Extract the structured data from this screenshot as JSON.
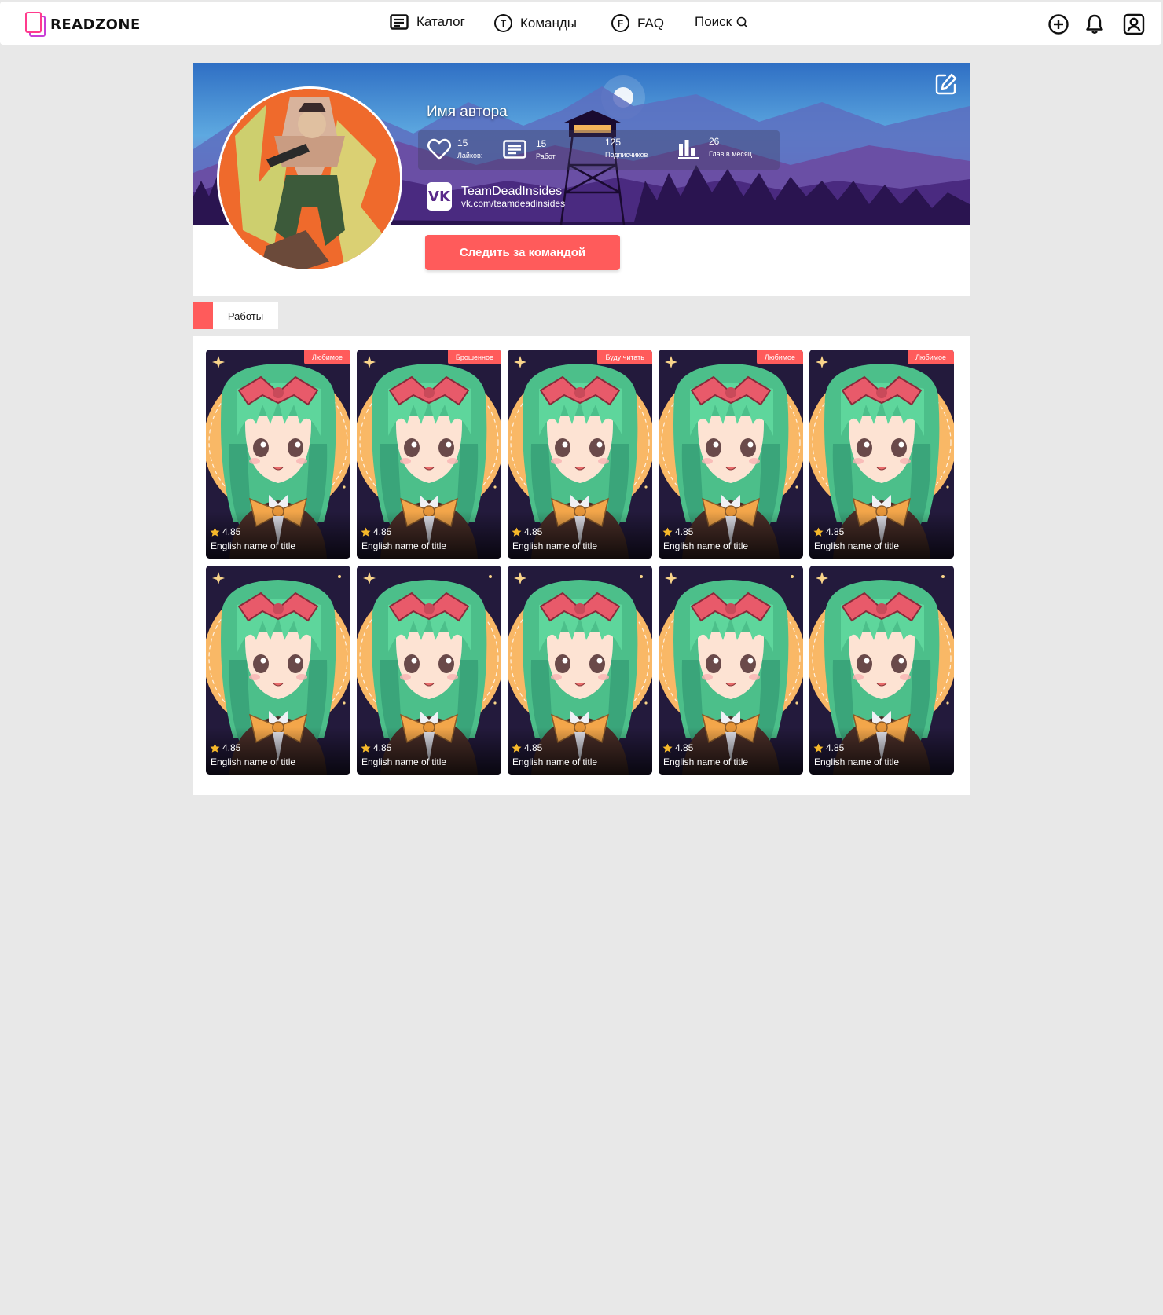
{
  "header": {
    "logo": "READZONE",
    "nav": {
      "catalog": "Каталог",
      "teams": "Команды",
      "faq": "FAQ",
      "search": "Поиск"
    }
  },
  "profile": {
    "author_name": "Имя автора",
    "stats": [
      {
        "value": "15",
        "label": "Лайков:"
      },
      {
        "value": "15",
        "label": "Работ"
      },
      {
        "value": "125",
        "label": "Подписчиков"
      },
      {
        "value": "26",
        "label": "Глав в месяц"
      }
    ],
    "vk": {
      "logo": "VK",
      "name": "TeamDeadInsides",
      "url": "vk.com/teamdeadinsides"
    },
    "follow_label": "Следить за командой"
  },
  "tabs": {
    "works_label": "Работы"
  },
  "works": [
    {
      "badge": "Любимое",
      "rating": "4.85",
      "title": "English name of title"
    },
    {
      "badge": "Брошенное",
      "rating": "4.85",
      "title": "English name of title"
    },
    {
      "badge": "Буду читать",
      "rating": "4.85",
      "title": "English name of title"
    },
    {
      "badge": "Любимое",
      "rating": "4.85",
      "title": "English name of title"
    },
    {
      "badge": "Любимое",
      "rating": "4.85",
      "title": "English name of title"
    },
    {
      "badge": "",
      "rating": "4.85",
      "title": "English name of title"
    },
    {
      "badge": "",
      "rating": "4.85",
      "title": "English name of title"
    },
    {
      "badge": "",
      "rating": "4.85",
      "title": "English name of title"
    },
    {
      "badge": "",
      "rating": "4.85",
      "title": "English name of title"
    },
    {
      "badge": "",
      "rating": "4.85",
      "title": "English name of title"
    }
  ],
  "colors": {
    "accent": "#ff5b5b",
    "background": "#e8e8e8",
    "logo_pink": "#ff3b8d",
    "logo_purple": "#c93fd6"
  }
}
